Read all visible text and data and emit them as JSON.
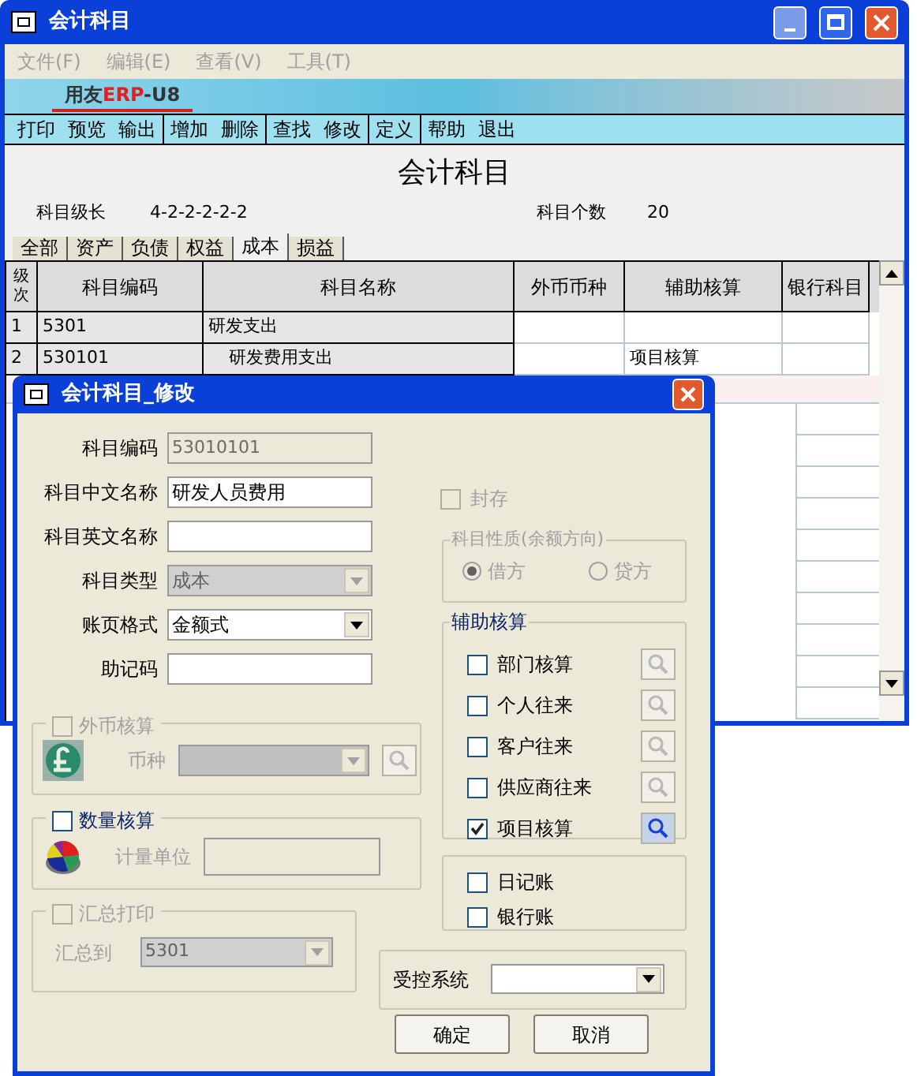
{
  "window": {
    "title": "会计科目"
  },
  "menu": [
    "文件(F)",
    "编辑(E)",
    "查看(V)",
    "工具(T)"
  ],
  "brand": {
    "left": "用友",
    "mid": "ERP",
    "right": "-U8"
  },
  "toolbar": [
    [
      "打印",
      "预览",
      "输出"
    ],
    [
      "增加",
      "删除"
    ],
    [
      "查找",
      "修改"
    ],
    [
      "定义"
    ],
    [
      "帮助",
      "退出"
    ]
  ],
  "report_title": "会计科目",
  "info": {
    "level_label": "科目级长",
    "level_value": "4-2-2-2-2-2",
    "count_label": "科目个数",
    "count_value": "20"
  },
  "tabs": [
    {
      "label": "全部",
      "selected": false
    },
    {
      "label": "资产",
      "selected": false
    },
    {
      "label": "负债",
      "selected": false
    },
    {
      "label": "权益",
      "selected": false
    },
    {
      "label": "成本",
      "selected": true
    },
    {
      "label": "损益",
      "selected": false
    }
  ],
  "table": {
    "columns": [
      "级次",
      "科目编码",
      "科目名称",
      "外币币种",
      "辅助核算",
      "银行科目"
    ],
    "rows": [
      {
        "level": "1",
        "code": "5301",
        "name": "研发支出",
        "indented": false
      },
      {
        "level": "2",
        "code": "530101",
        "name": "研发费用支出",
        "indented": true,
        "aux": "项目核算"
      }
    ]
  },
  "dialog": {
    "title": "会计科目_修改",
    "fields": [
      {
        "label": "科目编码",
        "kind": "text",
        "value": "53010101",
        "disabled": true
      },
      {
        "label": "科目中文名称",
        "kind": "text",
        "value": "研发人员费用",
        "disabled": false
      },
      {
        "label": "科目英文名称",
        "kind": "text",
        "disabled": false
      },
      {
        "label": "科目类型",
        "kind": "select",
        "value": "成本",
        "disabled": true
      },
      {
        "label": "账页格式",
        "kind": "select",
        "value": "金额式",
        "disabled": false
      },
      {
        "label": "助记码",
        "kind": "text",
        "disabled": false
      }
    ],
    "foreign_currency": {
      "label": "外币核算",
      "checked": false,
      "disabled": true,
      "field_label": "币种"
    },
    "quantity": {
      "label": "数量核算",
      "checked": false,
      "disabled": false,
      "field_label": "计量单位"
    },
    "summary_print": {
      "label": "汇总打印",
      "checked": false,
      "disabled": true,
      "field_label": "汇总到",
      "value": "5301"
    },
    "sealed": {
      "label": "封存",
      "checked": false,
      "disabled": true
    },
    "nature": {
      "title": "科目性质(余额方向)",
      "disabled": true,
      "options": [
        {
          "label": "借方",
          "selected": true
        },
        {
          "label": "贷方",
          "selected": false
        }
      ]
    },
    "aux": {
      "title": "辅助核算",
      "items": [
        {
          "label": "部门核算",
          "checked": false
        },
        {
          "label": "个人往来",
          "checked": false
        },
        {
          "label": "客户往来",
          "checked": false
        },
        {
          "label": "供应商往来",
          "checked": false
        },
        {
          "label": "项目核算",
          "checked": true
        }
      ]
    },
    "books": [
      {
        "label": "日记账",
        "checked": false
      },
      {
        "label": "银行账",
        "checked": false
      }
    ],
    "controlled": {
      "label": "受控系统"
    },
    "buttons": [
      "确定",
      "取消"
    ]
  }
}
